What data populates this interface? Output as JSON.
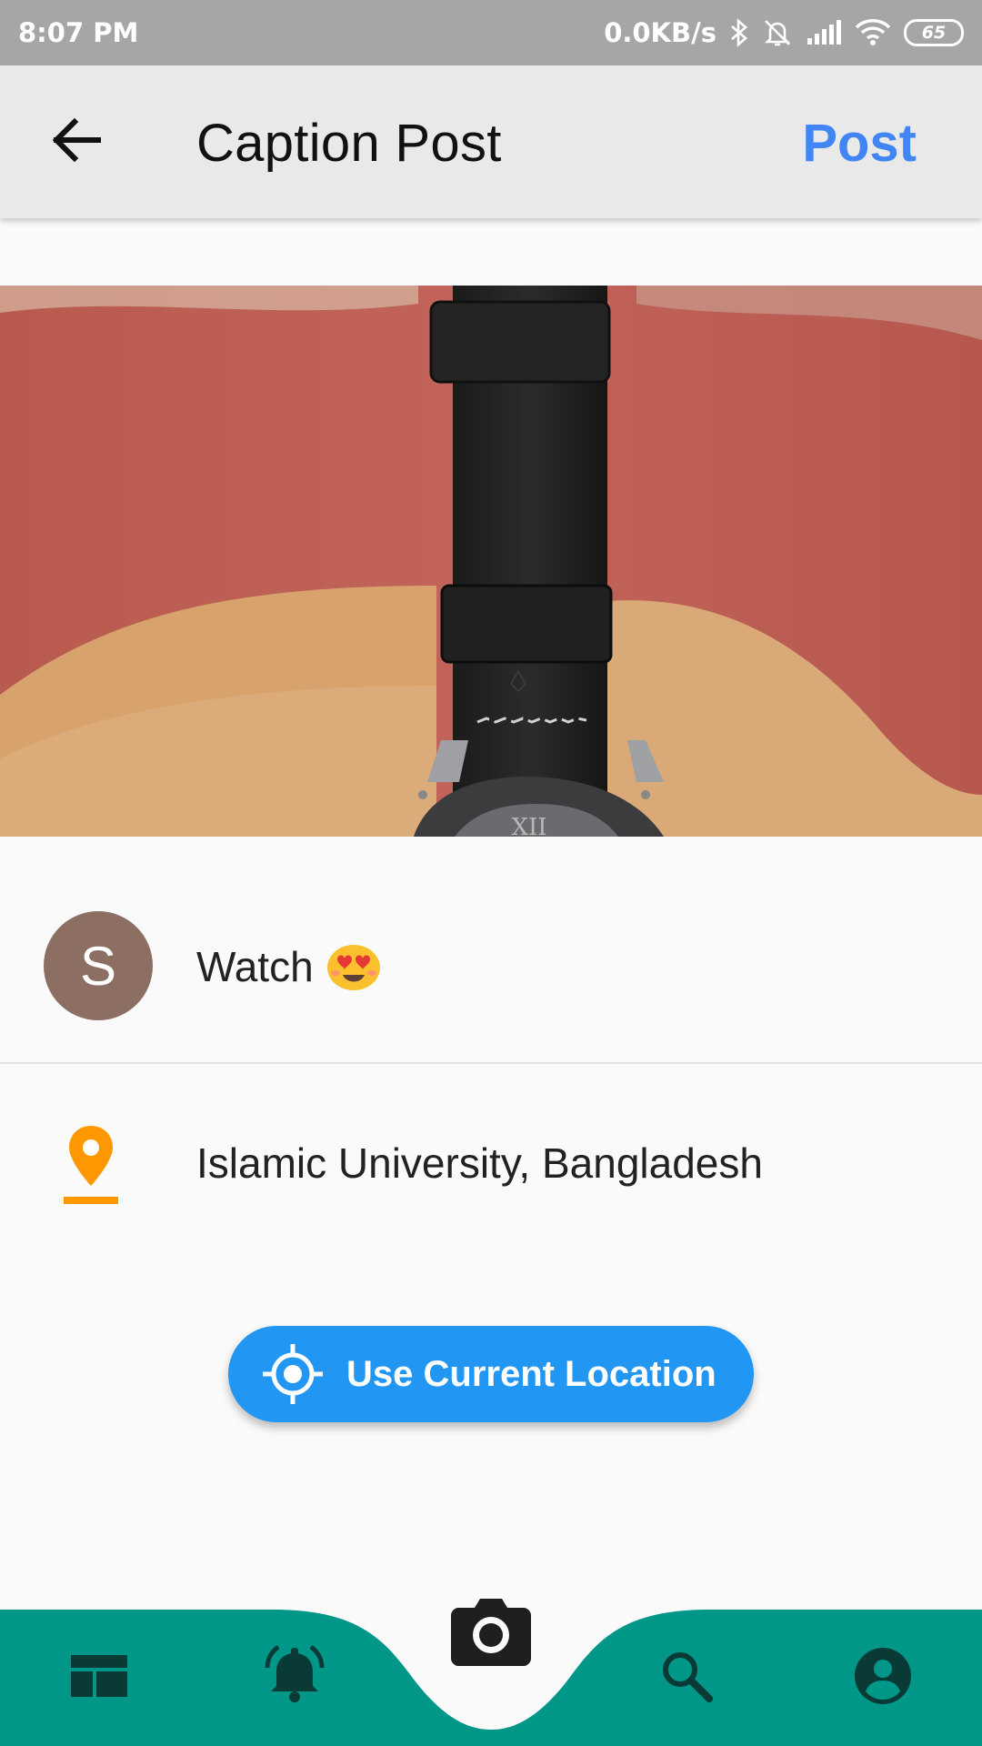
{
  "status_bar": {
    "time": "8:07 PM",
    "network_speed": "0.0KB/s",
    "battery_level": "65",
    "icons": [
      "bluetooth-icon",
      "muted-bell-icon",
      "signal-icon",
      "wifi-icon",
      "battery-icon"
    ]
  },
  "app_bar": {
    "title": "Caption Post",
    "post_label": "Post",
    "back_icon": "arrow-back-icon"
  },
  "caption": {
    "avatar_letter": "S",
    "text": "Watch",
    "emoji": "smiling-face-with-heart-eyes"
  },
  "location": {
    "text": "Islamic University, Bangladesh",
    "icon": "location-pin-icon"
  },
  "location_button": {
    "label": "Use Current Location",
    "icon": "gps-fixed-icon"
  },
  "bottom_nav": {
    "items": [
      "dashboard-icon",
      "notifications-icon",
      "camera-icon",
      "search-icon",
      "account-icon"
    ]
  },
  "colors": {
    "accent_blue": "#4285f4",
    "button_blue": "#2196f3",
    "nav_teal": "#009688",
    "pin_orange": "#ff9800",
    "avatar_brown": "#8d6e63",
    "status_bar_gray": "#a6a6a6",
    "app_bar_gray": "#e9e9e9"
  }
}
